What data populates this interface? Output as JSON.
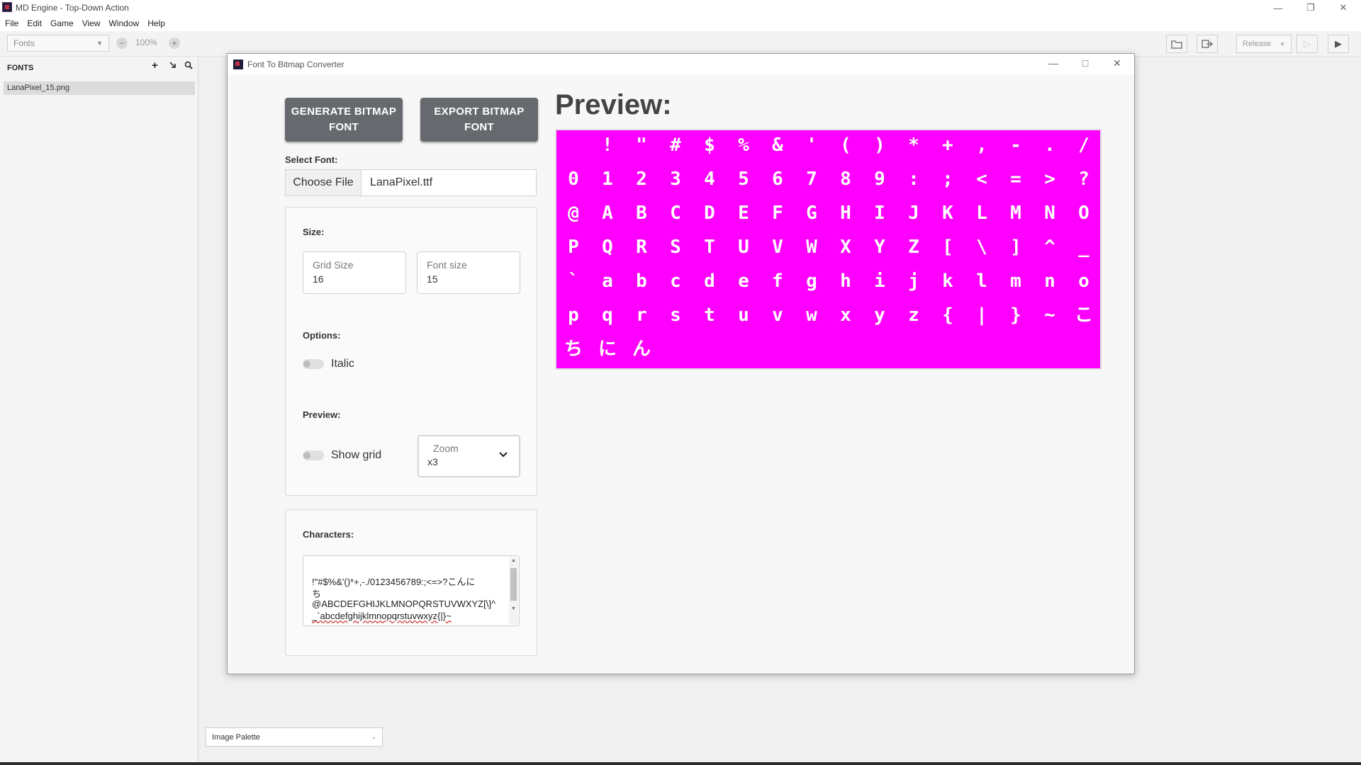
{
  "app": {
    "title": "MD Engine - Top-Down Action",
    "menu": [
      "File",
      "Edit",
      "Game",
      "View",
      "Window",
      "Help"
    ]
  },
  "toolbar": {
    "asset_type": "Fonts",
    "zoom": "100%",
    "build_mode": "Release"
  },
  "left_panel": {
    "header": "FONTS",
    "items": [
      "LanaPixel_15.png"
    ]
  },
  "bottom": {
    "palette": "Image Palette"
  },
  "dialog": {
    "title": "Font To Bitmap Converter",
    "generate_label": "GENERATE BITMAP FONT",
    "export_label": "EXPORT BITMAP FONT",
    "select_font_label": "Select Font:",
    "choose_file_label": "Choose File",
    "file_name": "LanaPixel.ttf",
    "size_label": "Size:",
    "grid_size_label": "Grid Size",
    "grid_size_value": "16",
    "font_size_label": "Font size",
    "font_size_value": "15",
    "options_label": "Options:",
    "italic_label": "Italic",
    "preview_section_label": "Preview:",
    "show_grid_label": "Show grid",
    "zoom_label": "Zoom",
    "zoom_value": "x3",
    "characters_label": "Characters:",
    "characters_lines": [
      " !\"#$%&'()*+,-./0123456789:;<=>?こんに",
      "ち",
      "@ABCDEFGHIJKLMNOPQRSTUVWXYZ[\\]^",
      "_`abcdefghijklmnopqrstuvwxyz{|}~"
    ],
    "preview_title": "Preview:",
    "preview_glyph_rows": [
      [
        " ",
        "!",
        "\"",
        "#",
        "$",
        "%",
        "&",
        "'",
        "(",
        ")",
        "*",
        "+",
        ",",
        "-",
        ".",
        "/"
      ],
      [
        "0",
        "1",
        "2",
        "3",
        "4",
        "5",
        "6",
        "7",
        "8",
        "9",
        ":",
        ";",
        "<",
        "=",
        ">",
        "?"
      ],
      [
        "@",
        "A",
        "B",
        "C",
        "D",
        "E",
        "F",
        "G",
        "H",
        "I",
        "J",
        "K",
        "L",
        "M",
        "N",
        "O"
      ],
      [
        "P",
        "Q",
        "R",
        "S",
        "T",
        "U",
        "V",
        "W",
        "X",
        "Y",
        "Z",
        "[",
        "\\",
        "]",
        "^",
        "_"
      ],
      [
        "`",
        "a",
        "b",
        "c",
        "d",
        "e",
        "f",
        "g",
        "h",
        "i",
        "j",
        "k",
        "l",
        "m",
        "n",
        "o"
      ],
      [
        "p",
        "q",
        "r",
        "s",
        "t",
        "u",
        "v",
        "w",
        "x",
        "y",
        "z",
        "{",
        "|",
        "}",
        "~",
        "こ"
      ],
      [
        "ち",
        "に",
        "ん"
      ]
    ]
  },
  "colors": {
    "preview_background": "#ff00ff",
    "button_background": "#666a6e"
  },
  "icons": {
    "zoom_out": "minus-circle-icon",
    "zoom_in": "plus-circle-icon",
    "add": "plus-icon",
    "import": "import-icon",
    "search": "search-icon",
    "folder": "folder-icon",
    "export": "export-icon",
    "play_outline": "play-outline-icon",
    "play": "play-icon"
  }
}
